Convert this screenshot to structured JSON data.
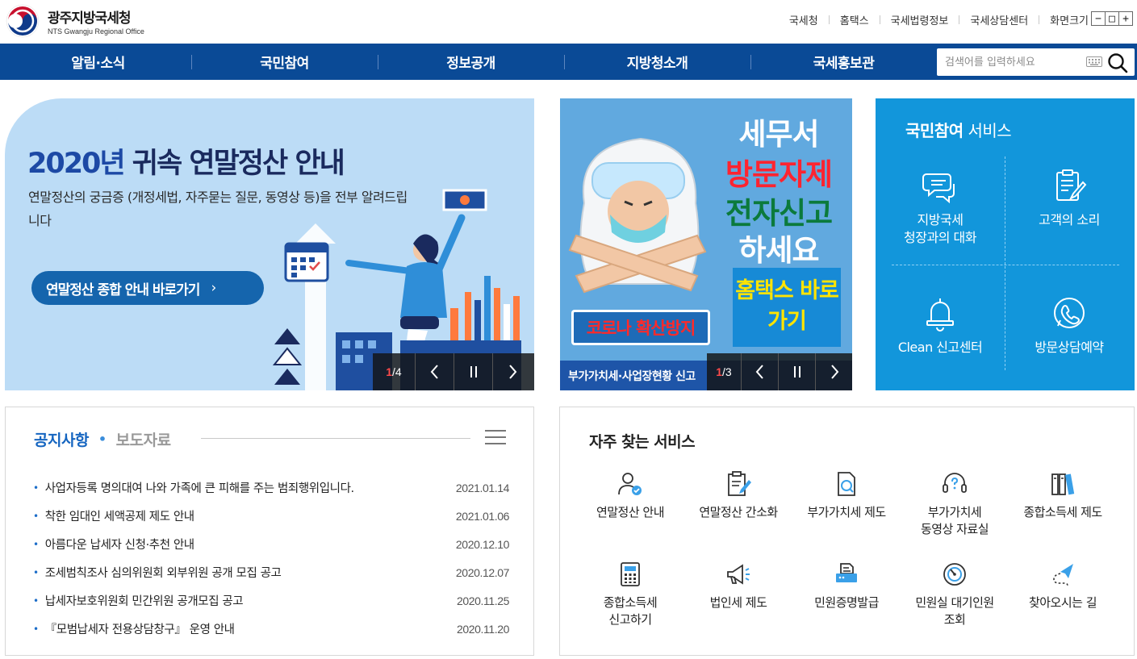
{
  "header": {
    "logo_ko": "광주지방국세청",
    "logo_en": "NTS Gwangju Regional Office",
    "util_links": [
      "국세청",
      "홈택스",
      "국세법령정보",
      "국세상담센터",
      "화면크기"
    ],
    "font_controls": [
      "−",
      "□",
      "+"
    ]
  },
  "nav": {
    "items": [
      "알림·소식",
      "국민참여",
      "정보공개",
      "지방청소개",
      "국세홍보관"
    ],
    "search_placeholder": "검색어를 입력하세요"
  },
  "banner_main": {
    "title_part1": "2020년",
    "title_part2": " 귀속 연말정산 안내",
    "desc": "연말정산의 궁금증 (개정세법, 자주묻는 질문, 동영상 등)을 전부 알려드립니다",
    "button": "연말정산 종합 안내 바로가기",
    "counter_current": "1",
    "counter_total": "/4"
  },
  "banner_covid": {
    "line1": "세무서",
    "line2": "방문자제",
    "line3": "전자신고",
    "line4": "하세요",
    "box": "홈택스 바로가기",
    "covid": "코로나 확산방지",
    "footer": "부가가치세·사업장현황 신고",
    "counter_current": "1",
    "counter_total": "/3"
  },
  "participation": {
    "title_bold": "국민참여",
    "title_rest": " 서비스",
    "items": [
      {
        "line1": "지방국세",
        "line2": "청장과의 대화",
        "icon": "chat-bubbles-icon"
      },
      {
        "line1": "고객의 소리",
        "line2": "",
        "icon": "clipboard-pen-icon"
      },
      {
        "line1": "Clean 신고센터",
        "line2": "",
        "icon": "bell-icon"
      },
      {
        "line1": "방문상담예약",
        "line2": "",
        "icon": "phone-icon"
      }
    ]
  },
  "notice": {
    "tab_active": "공지사항",
    "tab_idle": "보도자료",
    "items": [
      {
        "title": "사업자등록 명의대여 나와 가족에 큰 피해를 주는 범죄행위입니다.",
        "date": "2021.01.14"
      },
      {
        "title": "착한 임대인 세액공제 제도 안내",
        "date": "2021.01.06"
      },
      {
        "title": "아름다운 납세자 신청·추천 안내",
        "date": "2020.12.10"
      },
      {
        "title": "조세범칙조사 심의위원회 외부위원 공개 모집 공고",
        "date": "2020.12.07"
      },
      {
        "title": "납세자보호위원회 민간위원 공개모집 공고",
        "date": "2020.11.25"
      },
      {
        "title": "『모범납세자 전용상담창구』 운영 안내",
        "date": "2020.11.20"
      }
    ]
  },
  "frequent": {
    "title": "자주 찾는 서비스",
    "items": [
      {
        "line1": "연말정산 안내",
        "line2": "",
        "icon": "user-info-icon"
      },
      {
        "line1": "연말정산 간소화",
        "line2": "",
        "icon": "document-edit-icon"
      },
      {
        "line1": "부가가치세 제도",
        "line2": "",
        "icon": "document-search-icon"
      },
      {
        "line1": "부가가치세",
        "line2": "동영상 자료실",
        "icon": "headset-question-icon"
      },
      {
        "line1": "종합소득세 제도",
        "line2": "",
        "icon": "binders-icon"
      },
      {
        "line1": "종합소득세",
        "line2": "신고하기",
        "icon": "calculator-icon"
      },
      {
        "line1": "법인세 제도",
        "line2": "",
        "icon": "megaphone-icon"
      },
      {
        "line1": "민원증명발급",
        "line2": "",
        "icon": "printer-icon"
      },
      {
        "line1": "민원실 대기인원",
        "line2": "조회",
        "icon": "gauge-icon"
      },
      {
        "line1": "찾아오시는 길",
        "line2": "",
        "icon": "paper-plane-icon"
      }
    ]
  },
  "colors": {
    "nav": "#0a4a96",
    "accent": "#1565c0",
    "participation": "#1296db",
    "banner_main_bg": "#bcdcf6",
    "banner_covid_bg": "#61a9df"
  }
}
